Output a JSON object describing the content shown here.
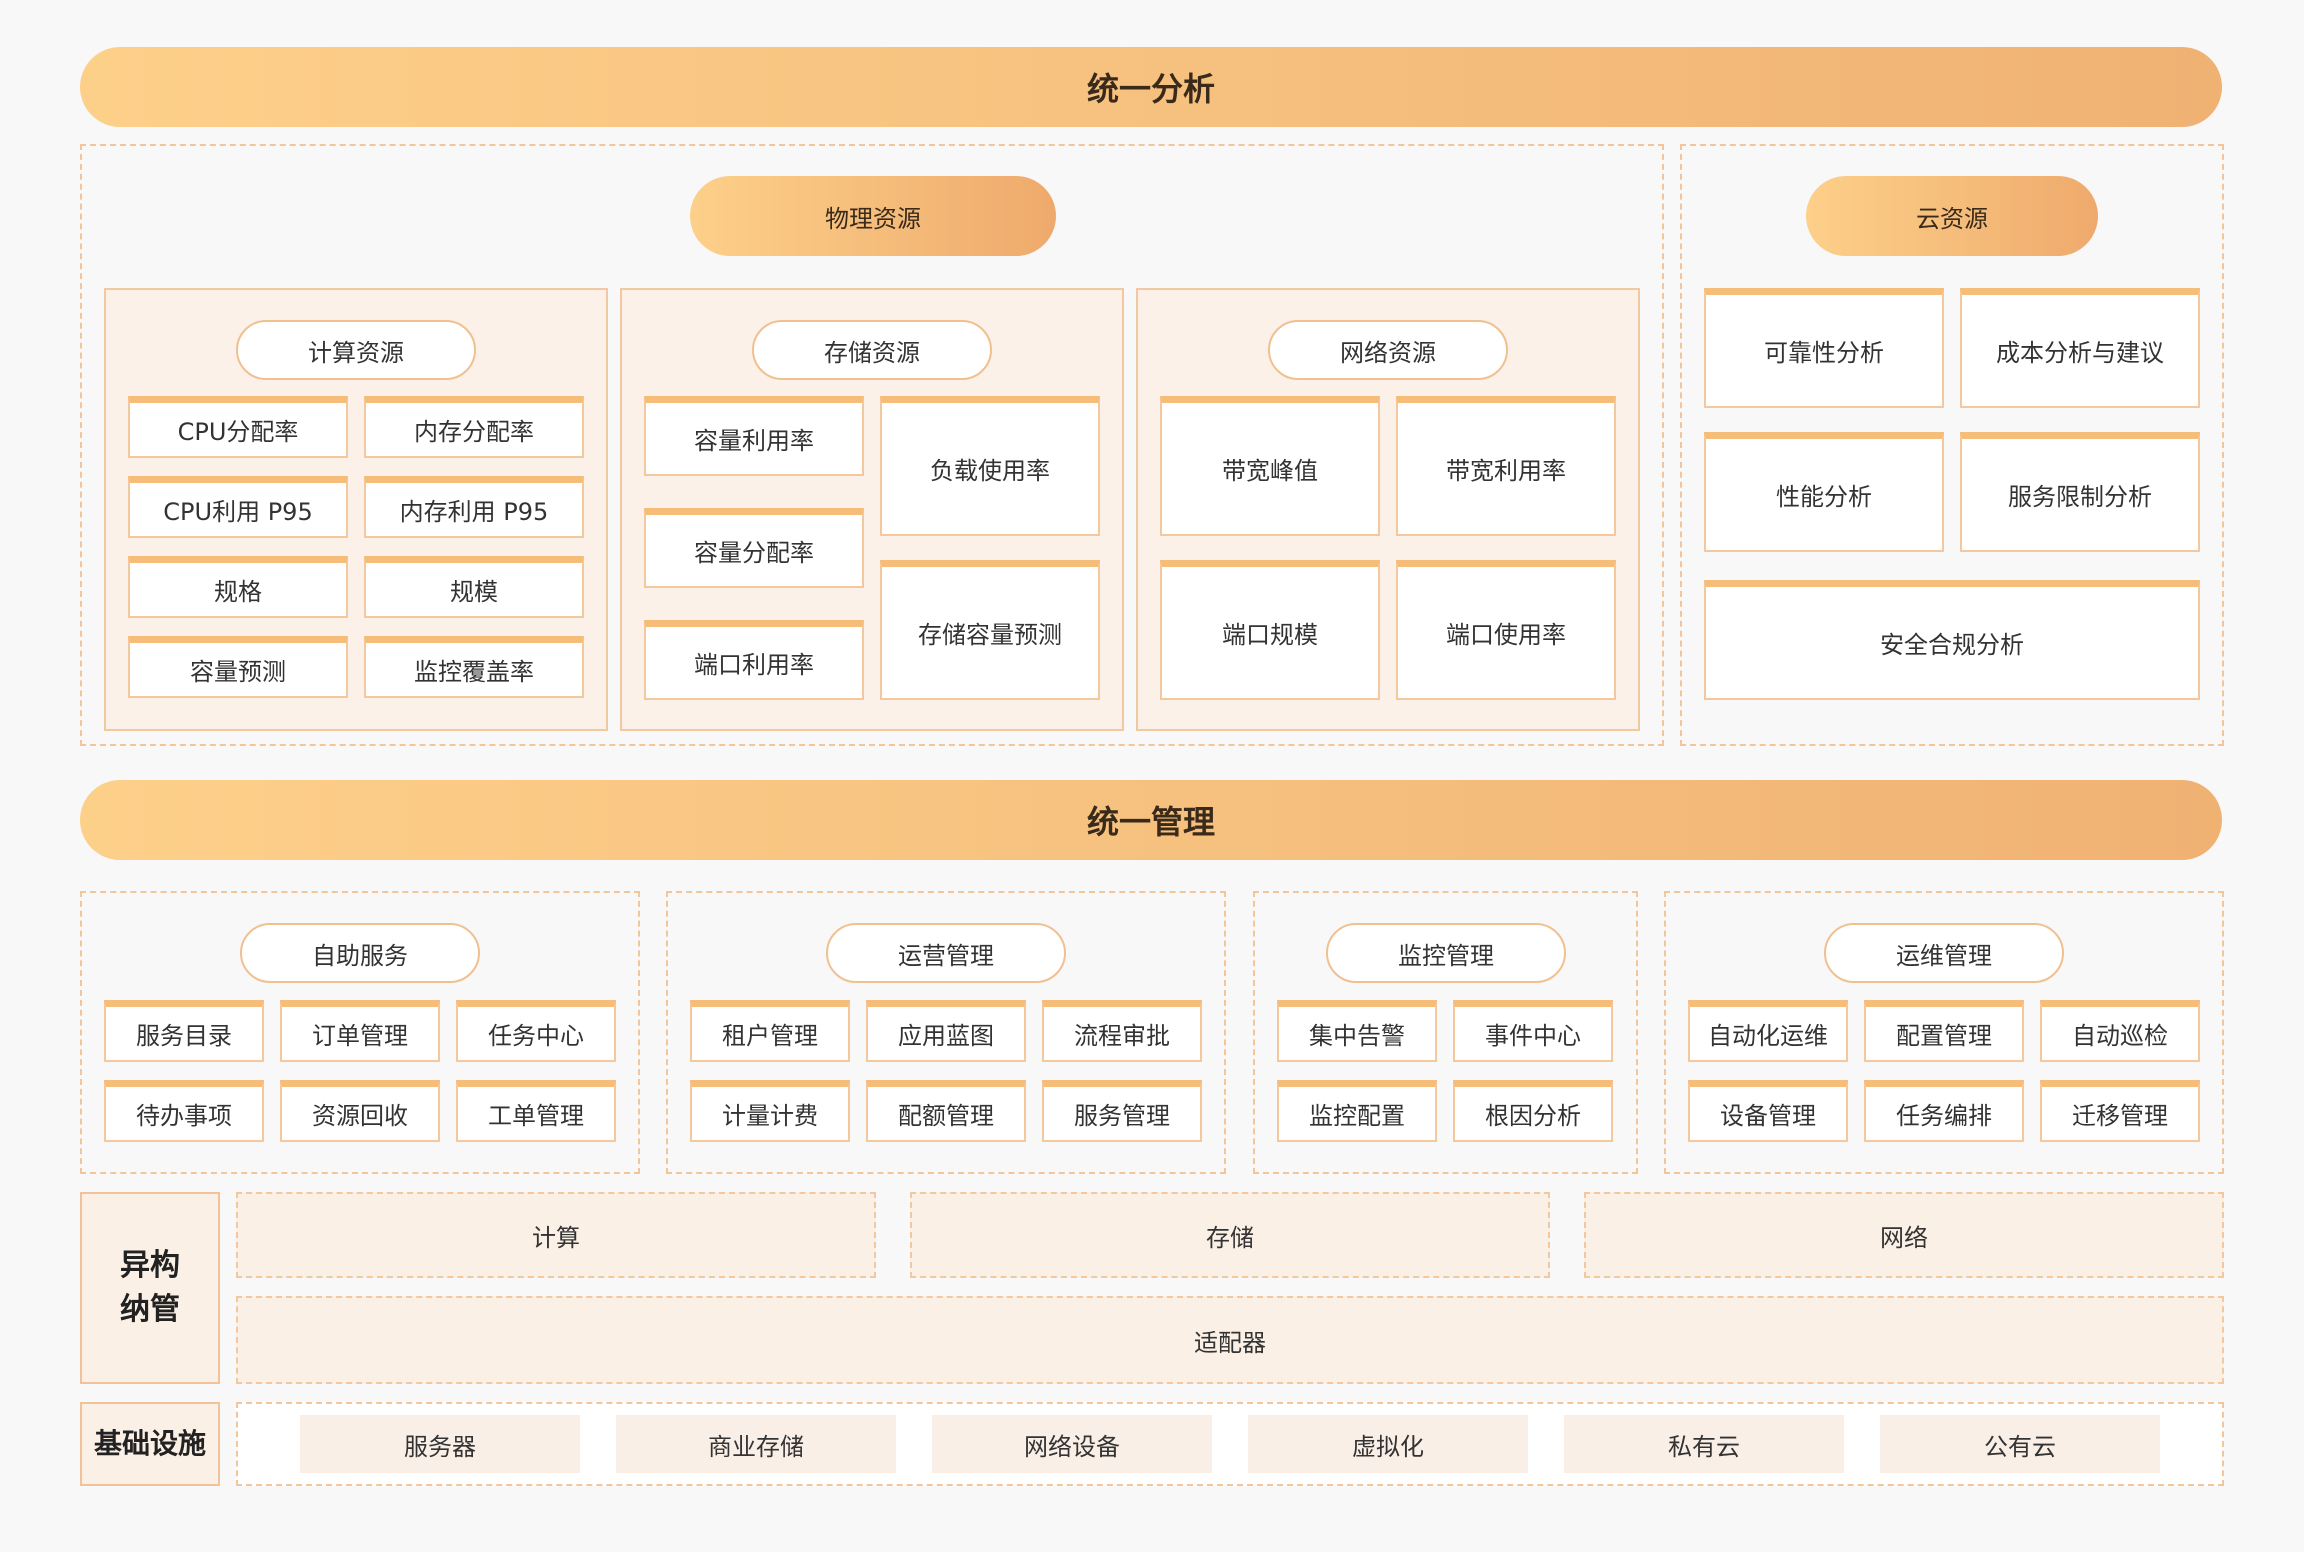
{
  "analysis": {
    "title": "统一分析",
    "physical": {
      "title": "物理资源",
      "compute": {
        "title": "计算资源",
        "items": [
          "CPU分配率",
          "内存分配率",
          "CPU利用 P95",
          "内存利用 P95",
          "规格",
          "规模",
          "容量预测",
          "监控覆盖率"
        ]
      },
      "storage": {
        "title": "存储资源",
        "left": [
          "容量利用率",
          "容量分配率",
          "端口利用率"
        ],
        "right": [
          "负载使用率",
          "存储容量预测"
        ]
      },
      "network": {
        "title": "网络资源",
        "items": [
          "带宽峰值",
          "带宽利用率",
          "端口规模",
          "端口使用率"
        ]
      }
    },
    "cloud": {
      "title": "云资源",
      "items": [
        "可靠性分析",
        "成本分析与建议",
        "性能分析",
        "服务限制分析",
        "安全合规分析"
      ]
    }
  },
  "management": {
    "title": "统一管理",
    "groups": [
      {
        "title": "自助服务",
        "items": [
          "服务目录",
          "订单管理",
          "任务中心",
          "待办事项",
          "资源回收",
          "工单管理"
        ]
      },
      {
        "title": "运营管理",
        "items": [
          "租户管理",
          "应用蓝图",
          "流程审批",
          "计量计费",
          "配额管理",
          "服务管理"
        ]
      },
      {
        "title": "监控管理",
        "items": [
          "集中告警",
          "事件中心",
          "监控配置",
          "根因分析"
        ]
      },
      {
        "title": "运维管理",
        "items": [
          "自动化运维",
          "配置管理",
          "自动巡检",
          "设备管理",
          "任务编排",
          "迁移管理"
        ]
      }
    ]
  },
  "hetero": {
    "label": "异构纳管",
    "items": [
      "计算",
      "存储",
      "网络"
    ],
    "adapter": "适配器"
  },
  "infra": {
    "label": "基础设施",
    "items": [
      "服务器",
      "商业存储",
      "网络设备",
      "虚拟化",
      "私有云",
      "公有云"
    ]
  }
}
